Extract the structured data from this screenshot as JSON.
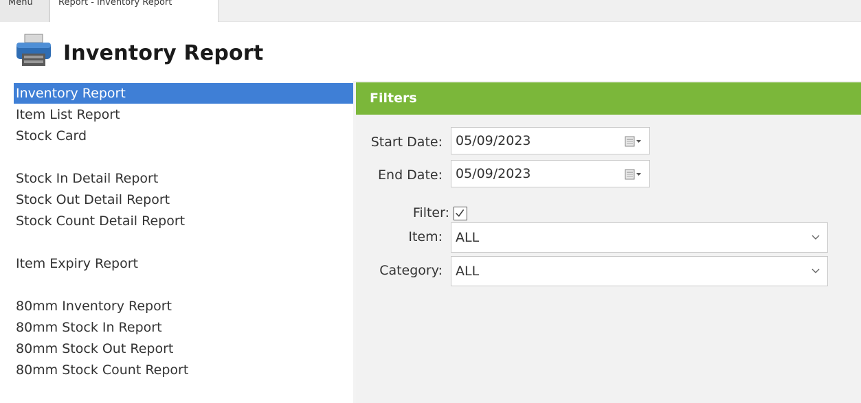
{
  "tabs": [
    {
      "label": "Menu"
    },
    {
      "label": "Report - Inventory Report"
    }
  ],
  "header": {
    "title": "Inventory Report",
    "icon": "printer-icon"
  },
  "reports": {
    "items": [
      {
        "label": "Inventory Report",
        "selected": true
      },
      {
        "label": "Item List Report"
      },
      {
        "label": "Stock Card"
      },
      {
        "label": "Stock In Detail Report"
      },
      {
        "label": "Stock Out Detail Report"
      },
      {
        "label": "Stock Count Detail Report"
      },
      {
        "label": "Item Expiry Report"
      },
      {
        "label": "80mm Inventory Report"
      },
      {
        "label": "80mm Stock In Report"
      },
      {
        "label": "80mm Stock Out Report"
      },
      {
        "label": "80mm Stock Count Report"
      }
    ]
  },
  "filters": {
    "title": "Filters",
    "start_date_label": "Start Date:",
    "start_date": "05/09/2023",
    "end_date_label": "End Date:",
    "end_date": "05/09/2023",
    "filter_label": "Filter:",
    "filter_checked": true,
    "item_label": "Item:",
    "item_value": "ALL",
    "category_label": "Category:",
    "category_value": "ALL"
  },
  "colors": {
    "accent_green": "#7bb73a",
    "selection_blue": "#3f7fd6"
  }
}
